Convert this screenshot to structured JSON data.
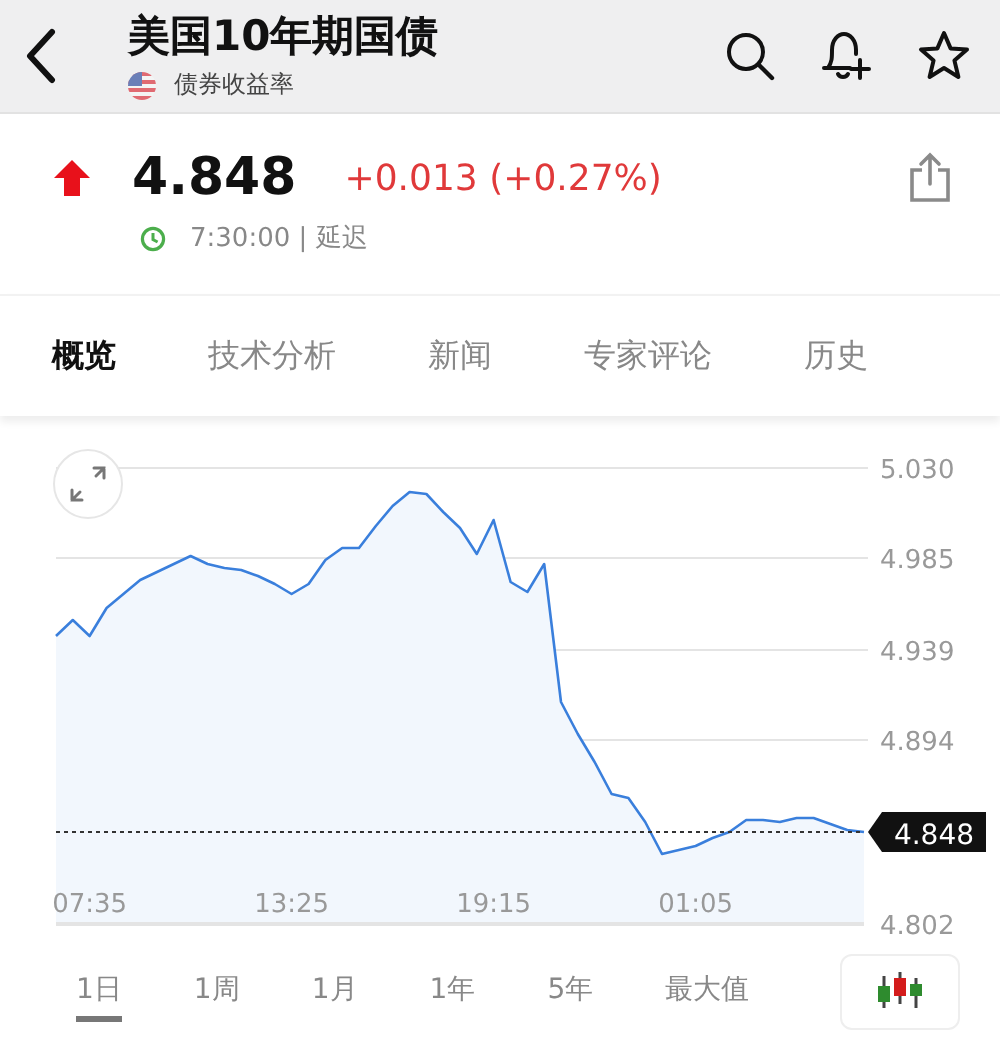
{
  "header": {
    "title": "美国10年期国债",
    "subtitle": "债券收益率"
  },
  "quote": {
    "rising": true,
    "price": "4.848",
    "change": "+0.013 (+0.27%)",
    "time": "7:30:00 | 延迟"
  },
  "tabs": [
    {
      "label": "概览",
      "selected": true
    },
    {
      "label": "技术分析",
      "selected": false
    },
    {
      "label": "新闻",
      "selected": false
    },
    {
      "label": "专家评论",
      "selected": false
    },
    {
      "label": "历史",
      "selected": false
    }
  ],
  "chart": {
    "chart_data": {
      "type": "area",
      "grid": true,
      "ref_lines": [
        {
          "axis": "y",
          "value": 4.848,
          "label": "4.848"
        }
      ],
      "categories": [
        null,
        null,
        "07:35",
        null,
        null,
        null,
        null,
        null,
        null,
        null,
        null,
        null,
        null,
        null,
        "13:25",
        null,
        null,
        null,
        null,
        null,
        null,
        null,
        null,
        null,
        null,
        null,
        "19:15",
        null,
        null,
        null,
        null,
        null,
        null,
        null,
        null,
        null,
        null,
        null,
        "01:05",
        null,
        null,
        null,
        null,
        null,
        null,
        null,
        null,
        null,
        null
      ],
      "series": [
        {
          "color": "#3a7fdc",
          "values": [
            4.946,
            4.954,
            4.946,
            4.96,
            4.967,
            4.974,
            4.978,
            4.982,
            4.986,
            4.982,
            4.98,
            4.979,
            4.976,
            4.972,
            4.967,
            4.972,
            4.984,
            4.99,
            4.99,
            5.001,
            5.011,
            5.018,
            5.017,
            5.008,
            5.0,
            4.987,
            5.004,
            4.973,
            4.968,
            4.982,
            4.913,
            4.897,
            4.883,
            4.867,
            4.865,
            4.853,
            4.837,
            4.839,
            4.841,
            4.845,
            4.848,
            4.854,
            4.854,
            4.853,
            4.855,
            4.855,
            4.852,
            4.849,
            4.848
          ]
        }
      ],
      "ylim": [
        4.802,
        5.03
      ],
      "yticks": [
        {
          "value": 5.03,
          "label": "5.030"
        },
        {
          "value": 4.985,
          "label": "4.985"
        },
        {
          "value": 4.939,
          "label": "4.939"
        },
        {
          "value": 4.894,
          "label": "4.894"
        },
        {
          "value": 4.802,
          "label": "4.802"
        }
      ]
    }
  },
  "periods": [
    {
      "label": "1日",
      "selected": true
    },
    {
      "label": "1周",
      "selected": false
    },
    {
      "label": "1月",
      "selected": false
    },
    {
      "label": "1年",
      "selected": false
    },
    {
      "label": "5年",
      "selected": false
    },
    {
      "label": "最大值",
      "selected": false
    }
  ]
}
